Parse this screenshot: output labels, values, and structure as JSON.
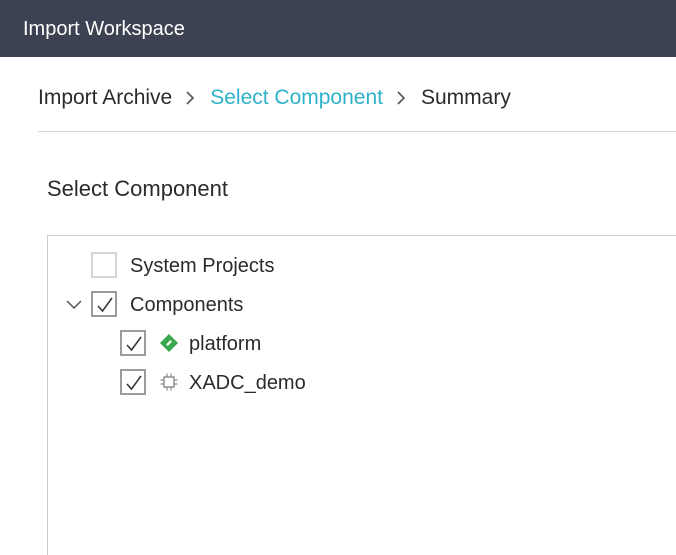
{
  "window": {
    "title": "Import Workspace"
  },
  "wizard": {
    "steps": [
      {
        "label": "Import Archive",
        "active": false
      },
      {
        "label": "Select Component",
        "active": true
      },
      {
        "label": "Summary",
        "active": false
      }
    ],
    "accent_color": "#2cb3c9"
  },
  "main": {
    "section_title": "Select Component"
  },
  "tree": {
    "nodes": [
      {
        "label": "System Projects",
        "checked": false,
        "level": 0,
        "expandable": false,
        "icon": "none"
      },
      {
        "label": "Components",
        "checked": true,
        "level": 0,
        "expandable": true,
        "expanded": true,
        "icon": "none"
      },
      {
        "label": "platform",
        "checked": true,
        "level": 1,
        "expandable": false,
        "icon": "platform-icon",
        "icon_color": "#3aa84f"
      },
      {
        "label": "XADC_demo",
        "checked": true,
        "level": 1,
        "expandable": false,
        "icon": "chip-icon",
        "icon_color": "#8a8a8a"
      }
    ]
  }
}
